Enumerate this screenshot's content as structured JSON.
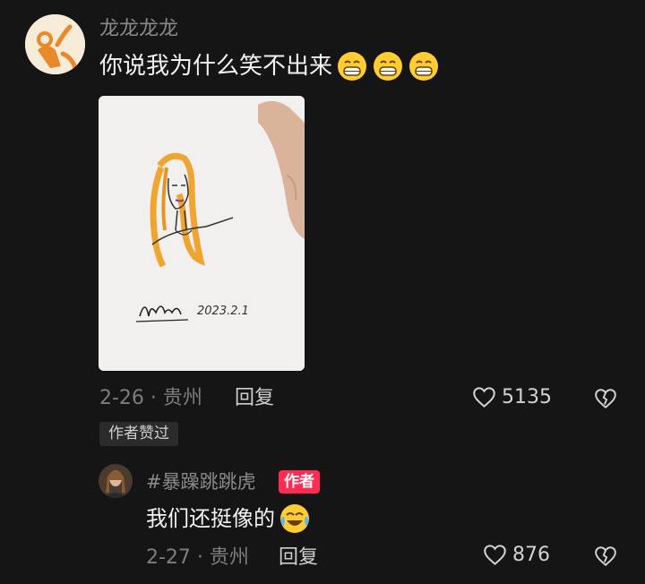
{
  "comment1": {
    "username": "龙龙龙龙",
    "text": "你说我为什么笑不出来",
    "emoji": "grinning-emoji",
    "emoji_count": 3,
    "date_location": "2-26 · 贵州",
    "reply_label": "回复",
    "likes": "5135",
    "author_liked_tag": "作者赞过",
    "photo_signature": "2023.2.1"
  },
  "comment2": {
    "username": "#暴躁跳跳虎",
    "author_badge": "作者",
    "text": "我们还挺像的",
    "emoji": "crying-laughing-emoji",
    "date_location": "2-27 · 贵州",
    "reply_label": "回复",
    "likes": "876"
  },
  "colors": {
    "background": "#151515",
    "badge": "#fe2c55",
    "muted_text": "#7d7d7d"
  }
}
